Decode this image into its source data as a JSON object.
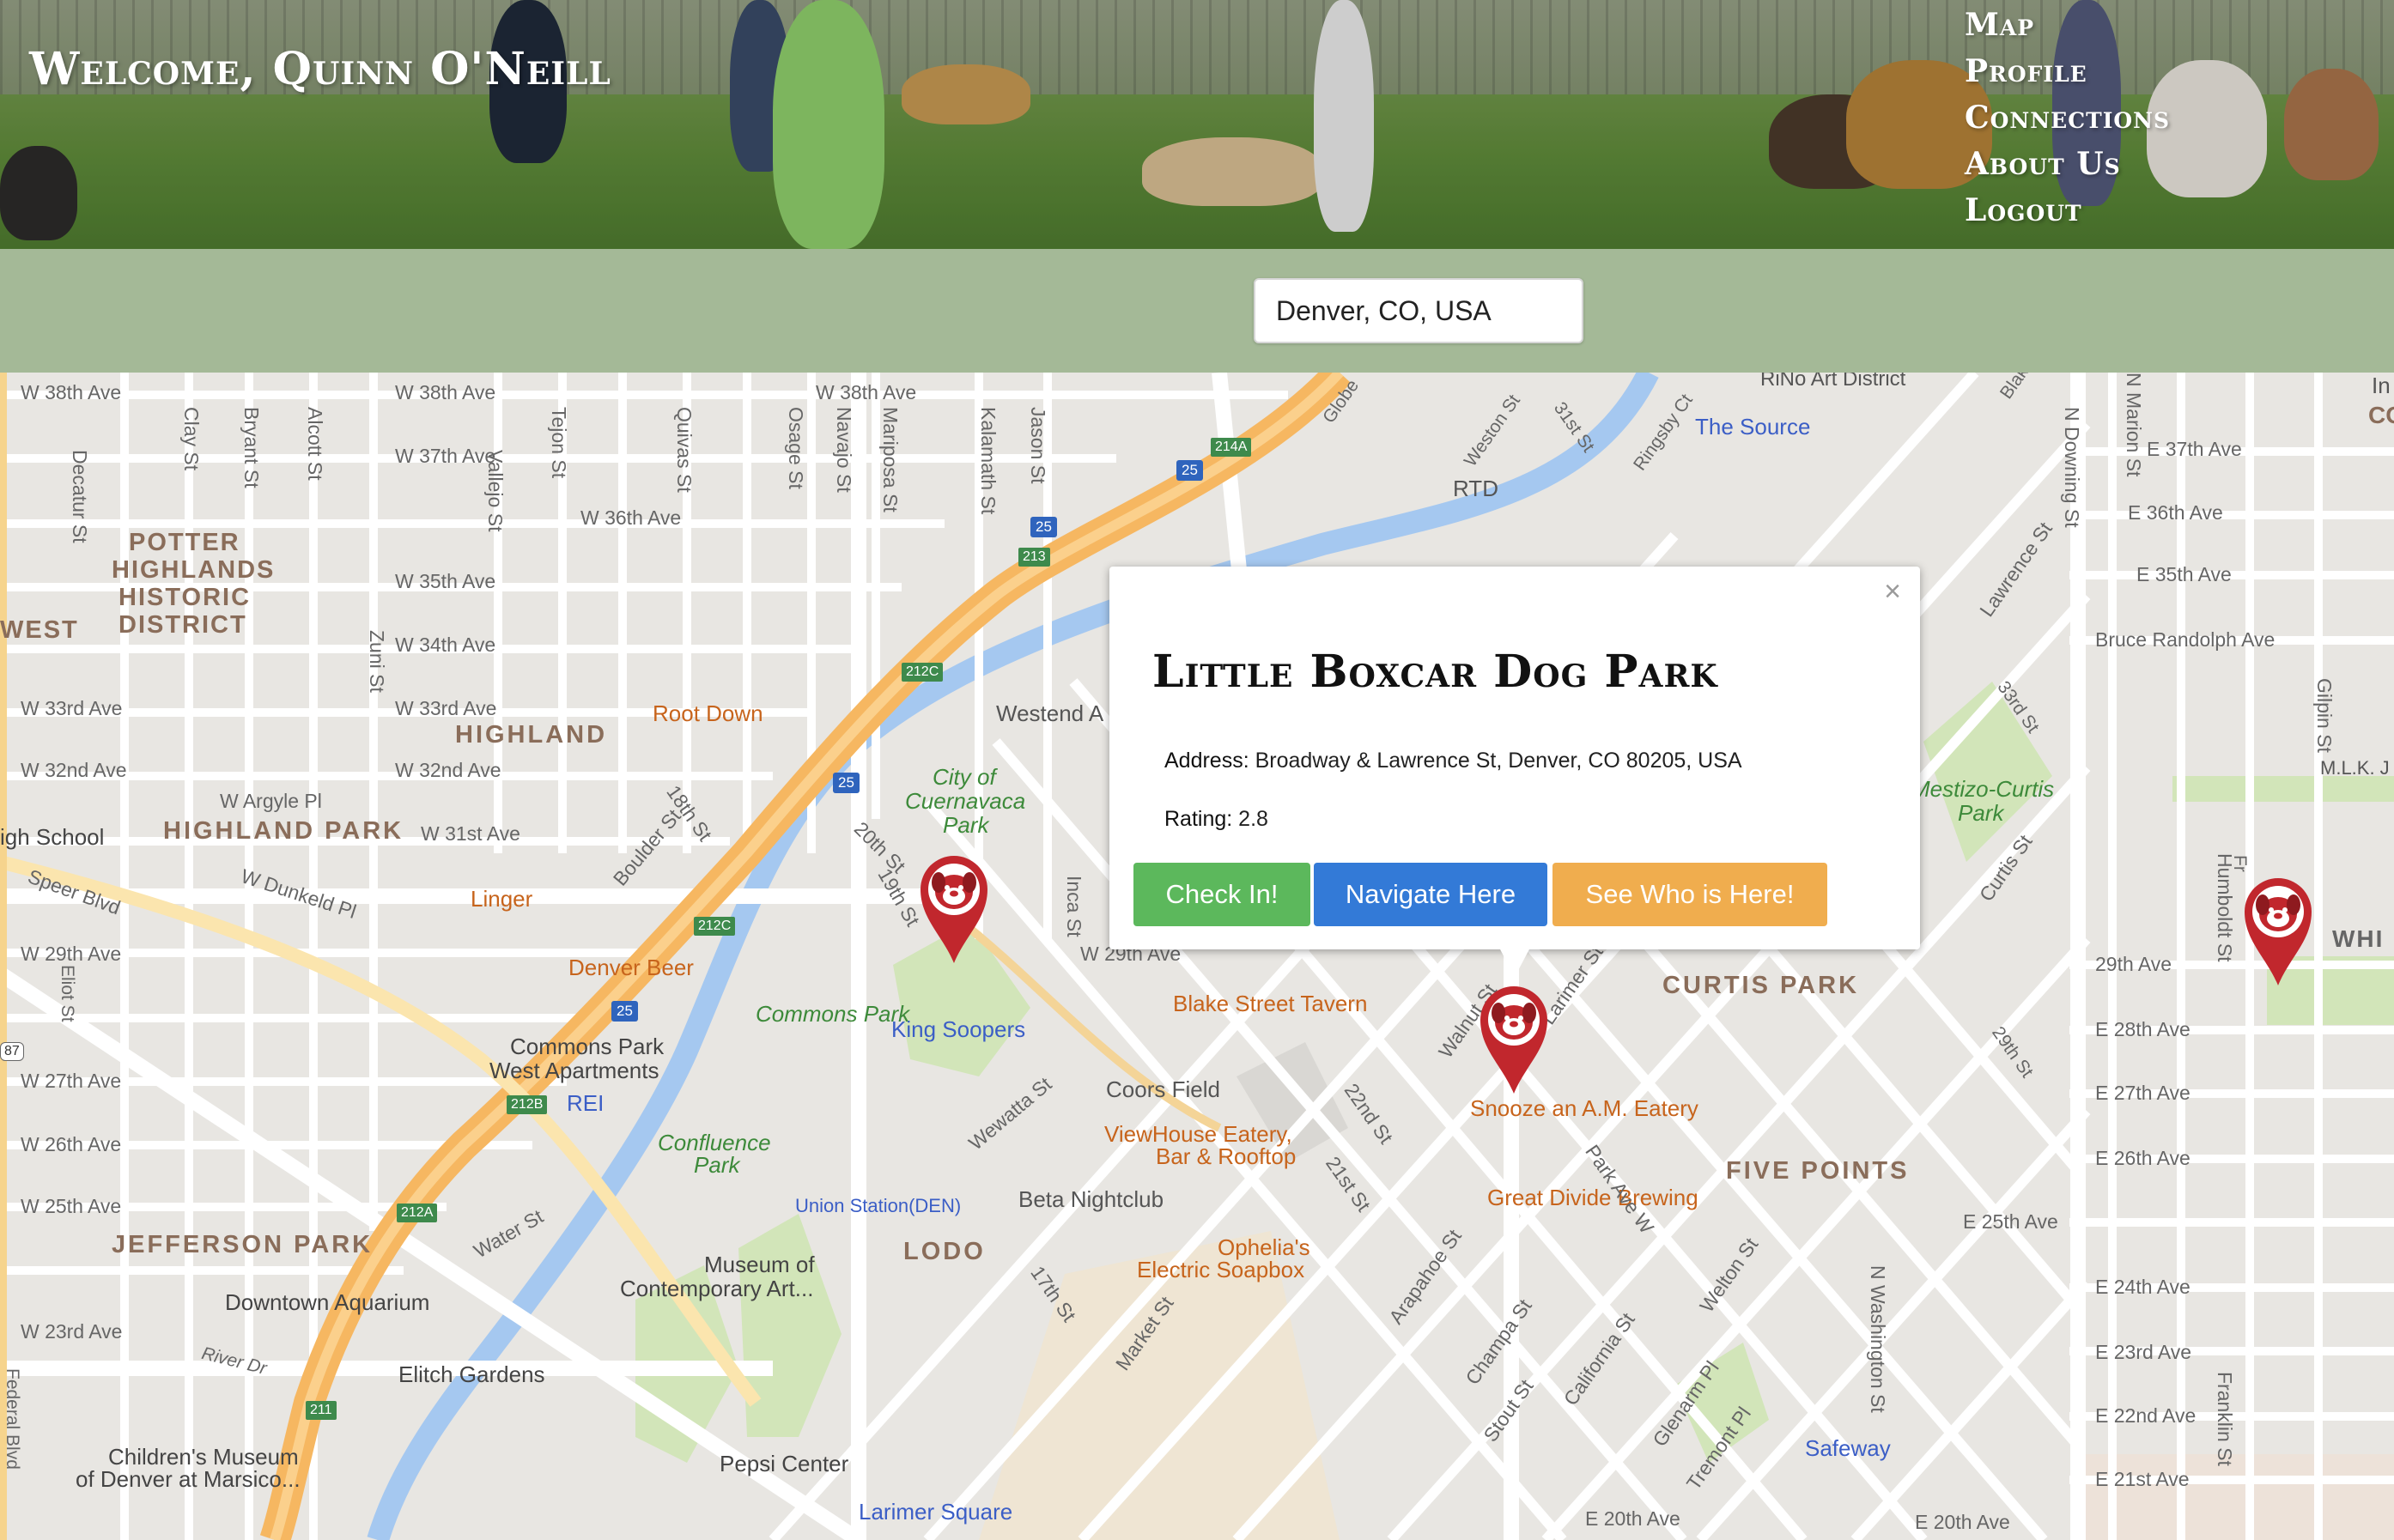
{
  "header": {
    "welcome": "Welcome, Quinn O'Neill",
    "nav": [
      "Map",
      "Profile",
      "Connections",
      "About Us",
      "Logout"
    ]
  },
  "search": {
    "value": "Denver, CO, USA"
  },
  "info_window": {
    "close": "×",
    "title": "Little Boxcar Dog Park",
    "address_label": "Address:",
    "address": "Broadway & Lawrence St, Denver, CO 80205, USA",
    "rating_label": "Rating:",
    "rating": "2.8",
    "buttons": {
      "check_in": "Check In!",
      "navigate": "Navigate Here",
      "who": "See Who is Here!"
    }
  },
  "map": {
    "neighborhoods": [
      "POTTER",
      "HIGHLANDS",
      "HISTORIC",
      "DISTRICT",
      "WEST",
      "HIGHLAND",
      "HIGHLAND PARK",
      "JEFFERSON PARK",
      "LODO",
      "CURTIS PARK",
      "FIVE POINTS"
    ],
    "places": [
      "Root Down",
      "Westend A",
      "Linger",
      "Denver Beer",
      "King Soopers",
      "Commons Park",
      "Commons Park",
      "West Apartments",
      "REI",
      "Confluence",
      "Park",
      "Blake Street Tavern",
      "Coors Field",
      "ViewHouse Eatery,",
      "Bar & Rooftop",
      "Snooze an A.M. Eatery",
      "Great Divide Brewing",
      "Beta Nightclub",
      "Union Station(DEN)",
      "Ophelia's",
      "Electric Soapbox",
      "Museum of",
      "Contemporary Art...",
      "Downtown Aquarium",
      "Elitch Gardens",
      "Children's Museum",
      "of Denver at Marsico...",
      "Pepsi Center",
      "Larimer Square",
      "Safeway",
      "The Source",
      "RTD",
      "RiNo Art District",
      "City of",
      "Cuernavaca",
      "Park",
      "Mestizo-Curtis",
      "Park",
      "igh School",
      "WHI",
      "In",
      "CO",
      "M.L.K. J"
    ],
    "streets": [
      "W 38th Ave",
      "W 38th Ave",
      "W 38th Ave",
      "W 37th Ave",
      "W 36th Ave",
      "W 35th Ave",
      "W 34th Ave",
      "W 33rd Ave",
      "W 33rd Ave",
      "W 32nd Ave",
      "W 32nd Ave",
      "W Argyle Pl",
      "W 31st Ave",
      "W Dunkeld Pl",
      "Speer Blvd",
      "W 29th Ave",
      "W 29th Ave",
      "W 27th Ave",
      "W 26th Ave",
      "W 25th Ave",
      "W 23rd Ave",
      "Water St",
      "River Dr",
      "E 37th Ave",
      "E 36th Ave",
      "E 35th Ave",
      "Bruce Randolph Ave",
      "29th Ave",
      "E 28th Ave",
      "E 27th Ave",
      "E 26th Ave",
      "E 25th Ave",
      "E 24th Ave",
      "E 23rd Ave",
      "E 22nd Ave",
      "E 21st Ave",
      "E 20th Ave",
      "E 20th Ave",
      "Decatur St",
      "Clay St",
      "Bryant St",
      "Alcott St",
      "Tejon St",
      "Quivas St",
      "Osage St",
      "Navajo St",
      "Mariposa St",
      "Kalamath St",
      "Jason St",
      "Zuni St",
      "Vallejo St",
      "Inca St",
      "20th St",
      "19th St",
      "18th St",
      "Boulder St",
      "Wewatta St",
      "Walnut St",
      "Larimer St",
      "22nd St",
      "21st St",
      "17th St",
      "Market St",
      "Arapahoe St",
      "Champa St",
      "Stout St",
      "California St",
      "Welton St",
      "Glenarm Pl",
      "Tremont Pl",
      "Curtis St",
      "Lawrence St",
      "Park Ave W",
      "N Downing St",
      "N Marion St",
      "N Washington St",
      "Humboldt St",
      "Franklin St",
      "Gilpin St",
      "Weston St",
      "31st St",
      "Ringsby Ct",
      "Globe",
      "Federal Blvd",
      "Eliot St",
      "33rd St",
      "Blak",
      "29th St",
      "Fr"
    ],
    "highways": [
      "25",
      "25",
      "25",
      "25",
      "214A",
      "213",
      "212C",
      "212C",
      "212B",
      "212A",
      "211",
      "87"
    ]
  },
  "colors": {
    "search_bar": "#a4b997",
    "pin": "#c1272d",
    "check_in": "#5cb85c",
    "navigate": "#337ad7",
    "who": "#f0ad4e"
  }
}
